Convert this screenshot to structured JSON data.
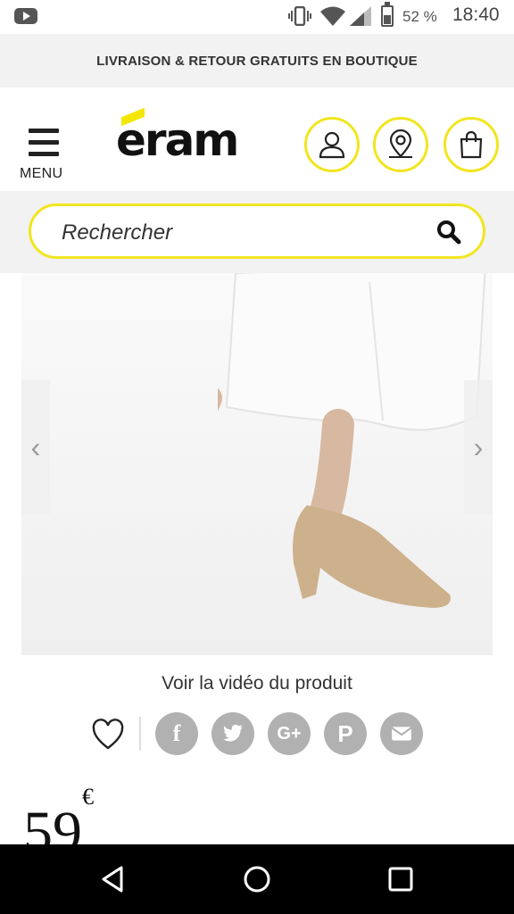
{
  "status_bar": {
    "battery_percent": "52 %",
    "time": "18:40",
    "icons": [
      "youtube-icon",
      "vibrate-icon",
      "wifi-icon",
      "signal-icon",
      "battery-icon"
    ]
  },
  "promo": {
    "text": "LIVRAISON & RETOUR GRATUITS EN BOUTIQUE"
  },
  "header": {
    "menu_label": "MENU",
    "logo_text": "eram",
    "icons": [
      "account-icon",
      "store-locator-icon",
      "shopping-bag-icon"
    ]
  },
  "search": {
    "placeholder": "Rechercher",
    "icon": "search-icon"
  },
  "product": {
    "video_link": "Voir la vidéo du produit",
    "price": "59",
    "currency": "€"
  },
  "share": {
    "items": [
      "f",
      "twitter",
      "G+",
      "P",
      "mail"
    ]
  },
  "colors": {
    "accent": "#f2e51f",
    "share_gray": "#b1b1b1"
  }
}
